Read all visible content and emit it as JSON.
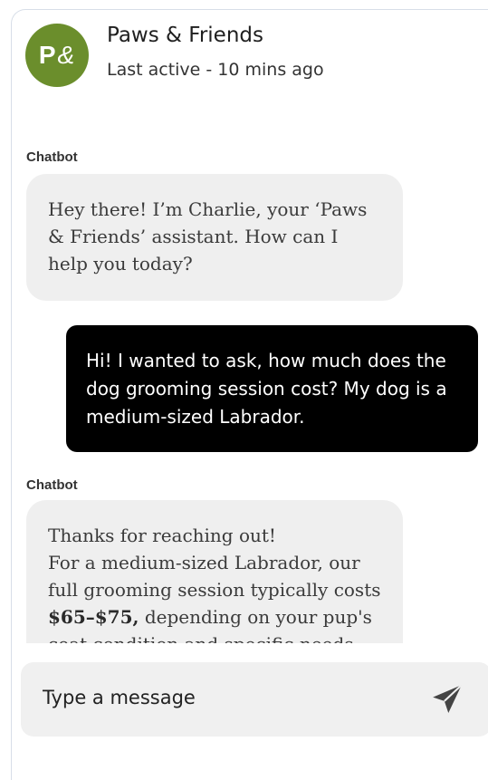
{
  "header": {
    "avatar_initials": "P",
    "avatar_amp": "&",
    "title": "Paws & Friends",
    "status": "Last active - 10 mins ago",
    "brand_color": "#6b8e2c"
  },
  "messages": [
    {
      "sender": "Chatbot",
      "role": "bot",
      "text": "Hey there! I’m Charlie, your ‘Paws & Friends’ assistant. How can I help you today?"
    },
    {
      "sender": "",
      "role": "user",
      "text": "Hi! I wanted to ask, how much does the dog grooming session cost? My dog is a medium-sized Labrador."
    },
    {
      "sender": "Chatbot",
      "role": "bot",
      "line1": "Thanks for reaching out!",
      "line2_prefix": "For a medium-sized Labrador, our full grooming session typically costs ",
      "price": "$65–$75,",
      "line2_suffix": " depending on your pup's coat condition and specific needs. This"
    }
  ],
  "composer": {
    "placeholder": "Type a message",
    "send_icon": "paper-plane-icon"
  }
}
